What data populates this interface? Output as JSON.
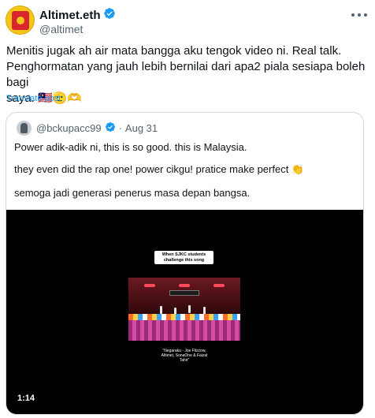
{
  "tweet": {
    "display_name": "Altimet.eth",
    "handle": "@altimet",
    "body": "Menitis jugak ah air mata bangga aku tengok video ni. Real talk.\nPenghormatan yang jauh lebih bernilai dari apa2 piala sesiapa boleh bagi\nsaya. 🇲🇾🫡🫶",
    "translate_label": "Translate post",
    "verified_icon": "verified-badge-icon",
    "more_icon": "more-options-icon"
  },
  "quote": {
    "handle": "@bckupacc99",
    "separator": "·",
    "date": "Aug 31",
    "lines": [
      "Power adik-adik ni, this is so good. this is Malaysia.",
      "they even did the rap one! power cikgu! pratice make perfect 👏",
      "semoga jadi generasi penerus masa depan bangsa."
    ],
    "video": {
      "caption": "When SJKC students challenge this song",
      "lyrics": "\"Negaraku - Joe Flizzow, Altimet, SonaOne & Faizal Tahir\"",
      "duration": "1:14"
    }
  },
  "colors": {
    "text": "#0f1419",
    "muted": "#536471",
    "link": "#1d9bf0",
    "verified": "#1d9bf0",
    "border": "#cfd9de"
  }
}
